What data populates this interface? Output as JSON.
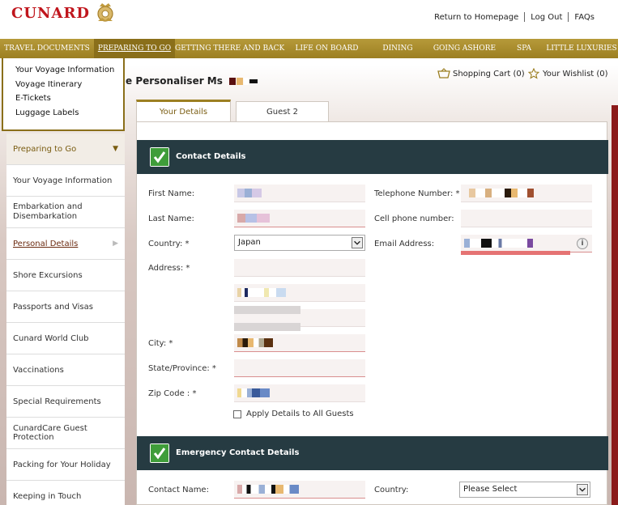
{
  "header": {
    "logo": "CUNARD",
    "links": [
      "Return to Homepage",
      "Log Out",
      "FAQs"
    ]
  },
  "nav": {
    "items": [
      {
        "label": "TRAVEL DOCUMENTS",
        "w": 116
      },
      {
        "label": "PREPARING TO GO",
        "w": 100,
        "active": true
      },
      {
        "label": "GETTING THERE AND BACK",
        "w": 135
      },
      {
        "label": "LIFE ON BOARD",
        "w": 105
      },
      {
        "label": "DINING",
        "w": 70
      },
      {
        "label": "GOING ASHORE",
        "w": 95
      },
      {
        "label": "SPA",
        "w": 52
      },
      {
        "label": "LITTLE LUXURIES",
        "w": 90
      }
    ]
  },
  "dropdown": {
    "items": [
      "Your Voyage Information",
      "Voyage Itinerary",
      "E-Tickets",
      "Luggage Labels"
    ]
  },
  "sidebar": {
    "items": [
      "Preparing to Go",
      "Your Voyage Information",
      "Embarkation and Disembarkation",
      "Personal Details",
      "Shore Excursions",
      "Passports and Visas",
      "Cunard World Club",
      "Vaccinations",
      "Special Requirements",
      "CunardCare Guest Protection",
      "Packing for Your Holiday",
      "Keeping in Touch"
    ]
  },
  "page": {
    "title": "e Personaliser Ms",
    "cart": "Shopping Cart (0)",
    "wishlist": "Your Wishlist (0)"
  },
  "tabs": [
    "Your Details",
    "Guest 2"
  ],
  "contact": {
    "heading": "Contact Details",
    "first_name": "First Name:",
    "last_name": "Last Name:",
    "country": "Country: *",
    "country_value": "Japan",
    "address": "Address: *",
    "city": "City: *",
    "state": "State/Province: *",
    "zip": "Zip Code : *",
    "telephone": "Telephone Number: *",
    "cell": "Cell phone number:",
    "email": "Email Address:",
    "apply_all": "Apply Details to All Guests"
  },
  "emergency": {
    "heading": "Emergency Contact Details",
    "contact_name": "Contact Name:",
    "country": "Country:",
    "country_value": "Please Select"
  },
  "icons": {
    "cart": "shopping-cart-icon",
    "wishlist": "star-icon",
    "check": "check-icon",
    "info": "info-icon",
    "crest": "crest-icon"
  },
  "colors": {
    "gold": "#9c7f22",
    "section": "#263b42",
    "check_green": "#3f9d3a",
    "brand_red": "#c0161d"
  }
}
